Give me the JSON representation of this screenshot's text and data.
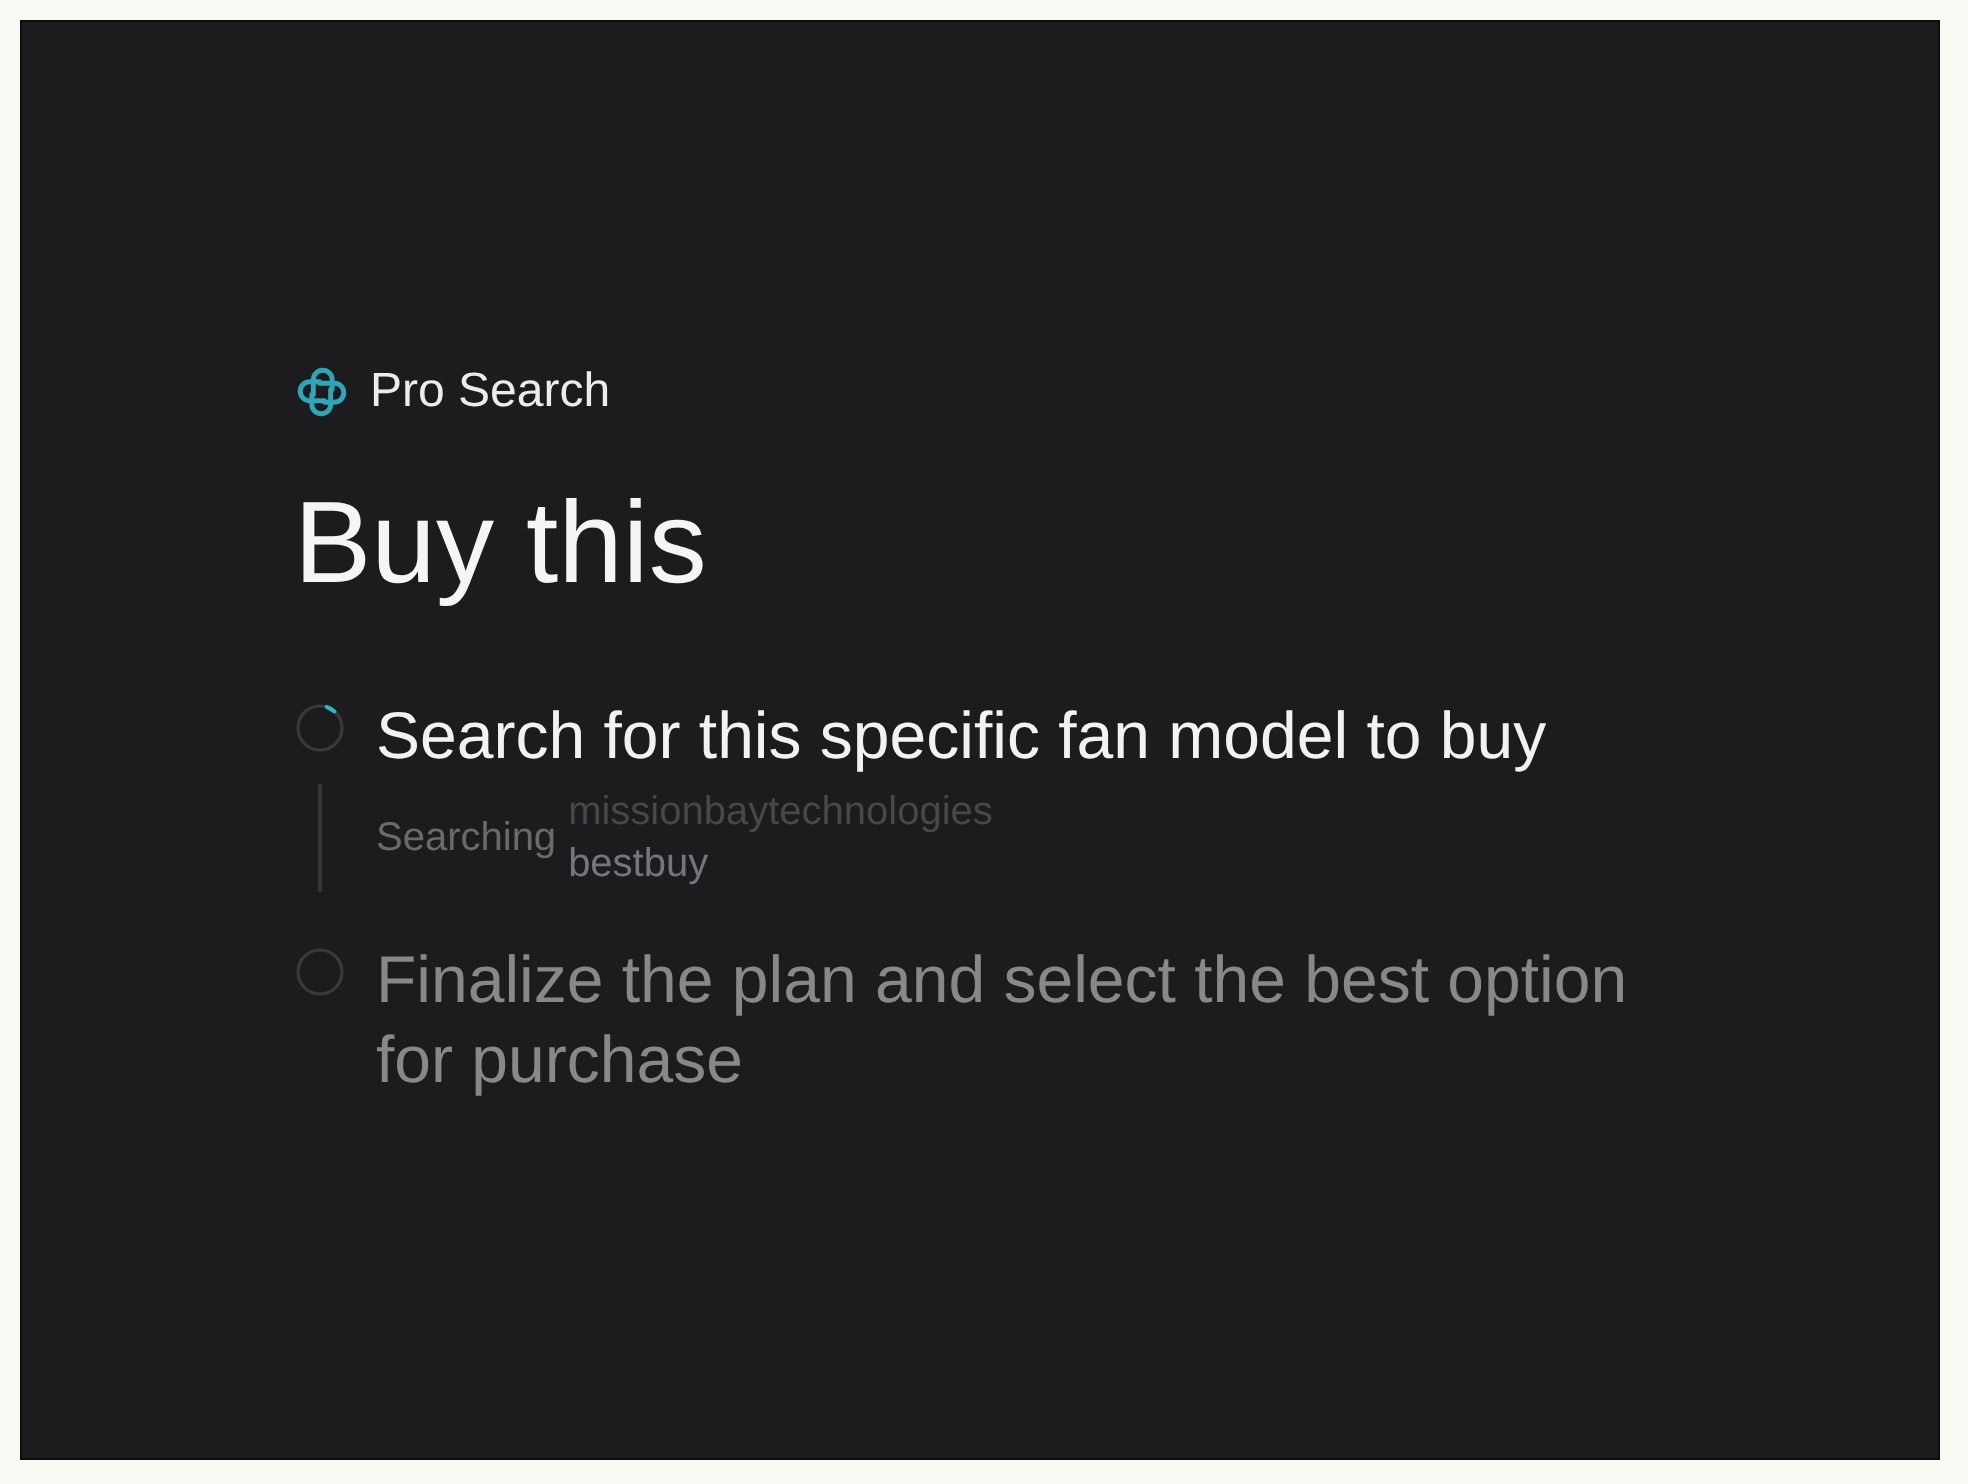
{
  "header": {
    "label": "Pro Search"
  },
  "title": "Buy this",
  "steps": [
    {
      "text": "Search for this specific fan model to buy",
      "active": true,
      "activity": {
        "label": "Searching",
        "sources": [
          {
            "name": "missionbaytechnologies",
            "faded": true
          },
          {
            "name": "bestbuy",
            "faded": false
          }
        ]
      }
    },
    {
      "text": "Finalize the plan and select the best option for purchase",
      "active": false
    }
  ]
}
